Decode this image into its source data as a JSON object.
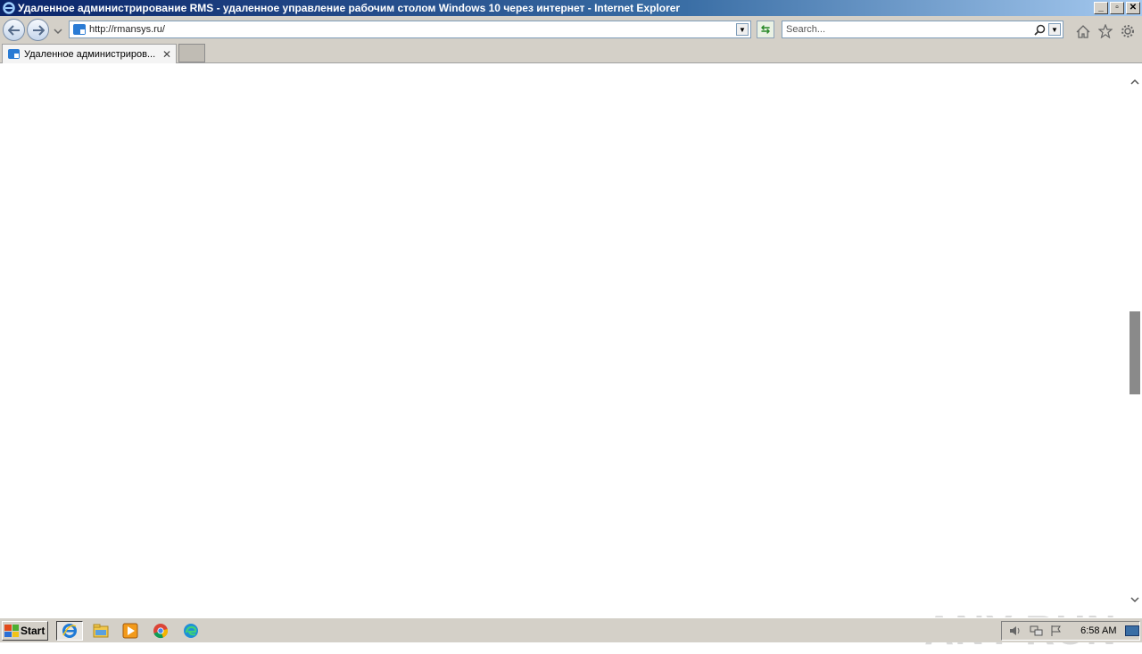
{
  "window": {
    "title": "Удаленное администрирование RMS - удаленное управление рабочим столом Windows 10 через интернет - Internet Explorer",
    "controls": {
      "minimize": "_",
      "restore": "▫",
      "close": "✕"
    }
  },
  "navbar": {
    "address": "http://rmansys.ru/",
    "search_placeholder": "Search...",
    "icons": [
      "back-icon",
      "forward-icon",
      "refresh-icon",
      "search-icon",
      "home-icon",
      "favorites-star-icon",
      "settings-gear-icon"
    ]
  },
  "tabs": [
    {
      "label": "Удаленное администриров...",
      "close": "✕"
    }
  ],
  "scrollbar": {
    "position_fraction": 0.45
  },
  "watermark": {
    "text": "ANY RUN"
  },
  "taskbar": {
    "start_label": "Start",
    "apps": [
      "internet-explorer-icon",
      "file-explorer-icon",
      "media-player-icon",
      "chrome-icon",
      "edge-icon"
    ],
    "clock": "6:58 AM"
  }
}
